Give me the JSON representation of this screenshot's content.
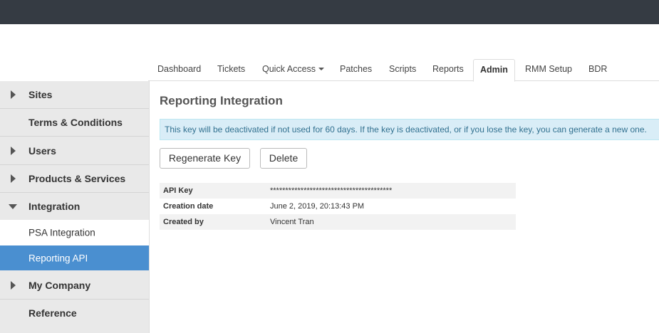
{
  "tabs": [
    {
      "label": "Dashboard"
    },
    {
      "label": "Tickets"
    },
    {
      "label": "Quick Access"
    },
    {
      "label": "Patches"
    },
    {
      "label": "Scripts"
    },
    {
      "label": "Reports"
    },
    {
      "label": "Admin"
    },
    {
      "label": "RMM Setup"
    },
    {
      "label": "BDR"
    }
  ],
  "sidebar": {
    "sites": "Sites",
    "terms": "Terms & Conditions",
    "users": "Users",
    "products": "Products & Services",
    "integration": "Integration",
    "psa_integration": "PSA Integration",
    "reporting_api": "Reporting API",
    "my_company": "My Company",
    "reference": "Reference"
  },
  "main": {
    "title": "Reporting Integration",
    "alert": "This key will be deactivated if not used for 60 days. If the key is deactivated, or if you lose the key, you can generate a new one.",
    "regenerate_label": "Regenerate Key",
    "delete_label": "Delete",
    "rows": [
      {
        "key": "API Key",
        "value": "****************************************"
      },
      {
        "key": "Creation date",
        "value": "June 2, 2019, 20:13:43 PM"
      },
      {
        "key": "Created by",
        "value": "Vincent Tran"
      }
    ]
  },
  "colors": {
    "topbar": "#353b43",
    "active_sidebar": "#4a8fd0",
    "alert_bg": "#d9edf7",
    "alert_text": "#31708f"
  }
}
